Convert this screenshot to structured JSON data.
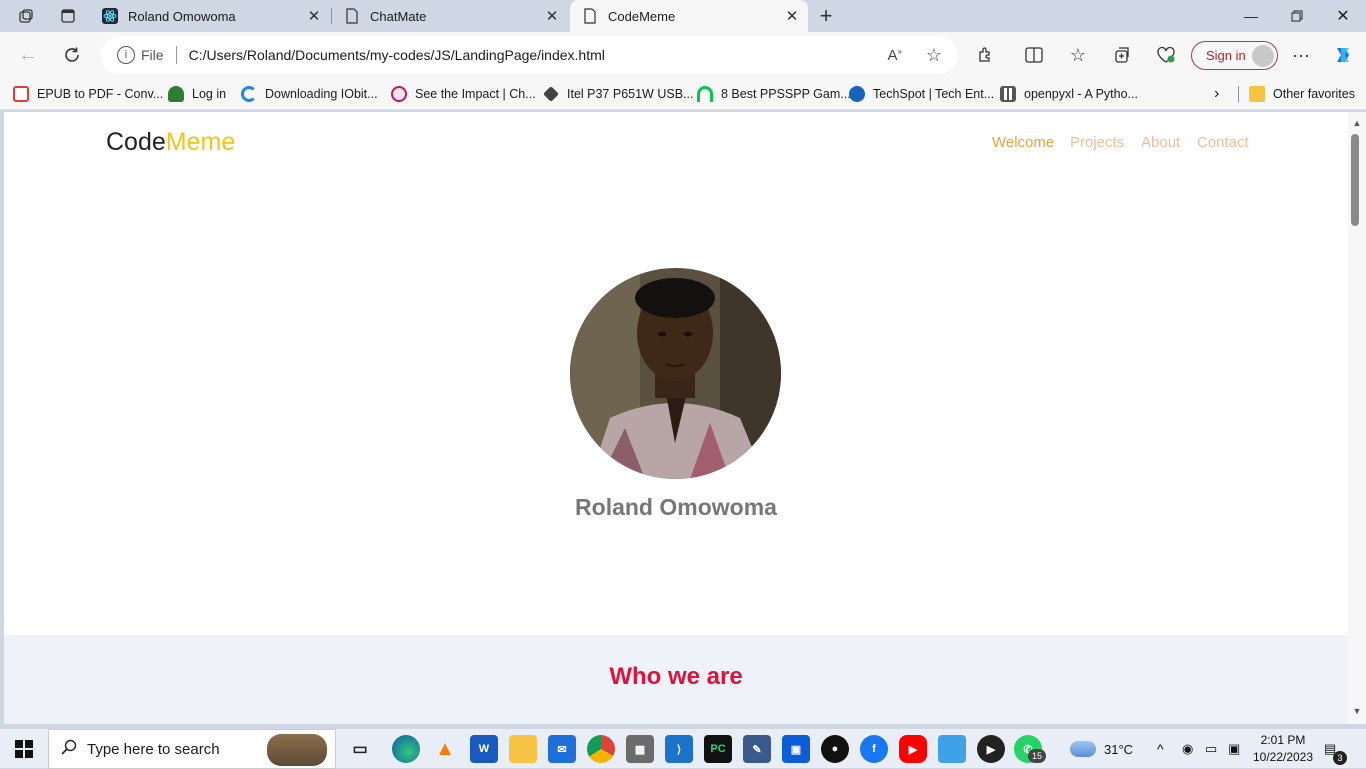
{
  "browser": {
    "tabs": [
      {
        "label": "Roland Omowoma",
        "icon": "react-icon"
      },
      {
        "label": "ChatMate",
        "icon": "page-icon"
      },
      {
        "label": "CodeMeme",
        "icon": "page-icon",
        "active": true
      }
    ],
    "address": {
      "scheme_label": "File",
      "url": "C:/Users/Roland/Documents/my-codes/JS/LandingPage/index.html"
    },
    "sign_in_label": "Sign in",
    "bookmarks": [
      {
        "label": "EPUB to PDF - Conv...",
        "color": "#e53935"
      },
      {
        "label": "Log in",
        "color": "#2e7d32"
      },
      {
        "label": "Downloading IObit...",
        "color": "#1e88e5"
      },
      {
        "label": "See the Impact | Ch...",
        "color": "#c2185b"
      },
      {
        "label": "Itel P37 P651W USB...",
        "color": "#424242"
      },
      {
        "label": "8 Best PPSSPP Gam...",
        "color": "#00c853"
      },
      {
        "label": "TechSpot | Tech Ent...",
        "color": "#1565c0"
      },
      {
        "label": "openpyxl - A Pytho...",
        "color": "#555555"
      }
    ],
    "other_favorites_label": "Other favorites"
  },
  "page": {
    "logo_part1": "Code",
    "logo_part2": "Meme",
    "nav": [
      {
        "label": "Welcome",
        "active": true
      },
      {
        "label": "Projects"
      },
      {
        "label": "About"
      },
      {
        "label": "Contact"
      }
    ],
    "profile_name": "Roland Omowoma",
    "section_title": "Who we are"
  },
  "taskbar": {
    "search_placeholder": "Type here to search",
    "weather": "31°C",
    "time": "2:01 PM",
    "date": "10/22/2023",
    "whatsapp_badge": "15",
    "notification_badge": "3"
  },
  "colors": {
    "accent_yellow": "#f4c414",
    "nav_active": "#e9a33a",
    "nav_inactive": "#e7c09b",
    "section_title": "#dc143c"
  }
}
